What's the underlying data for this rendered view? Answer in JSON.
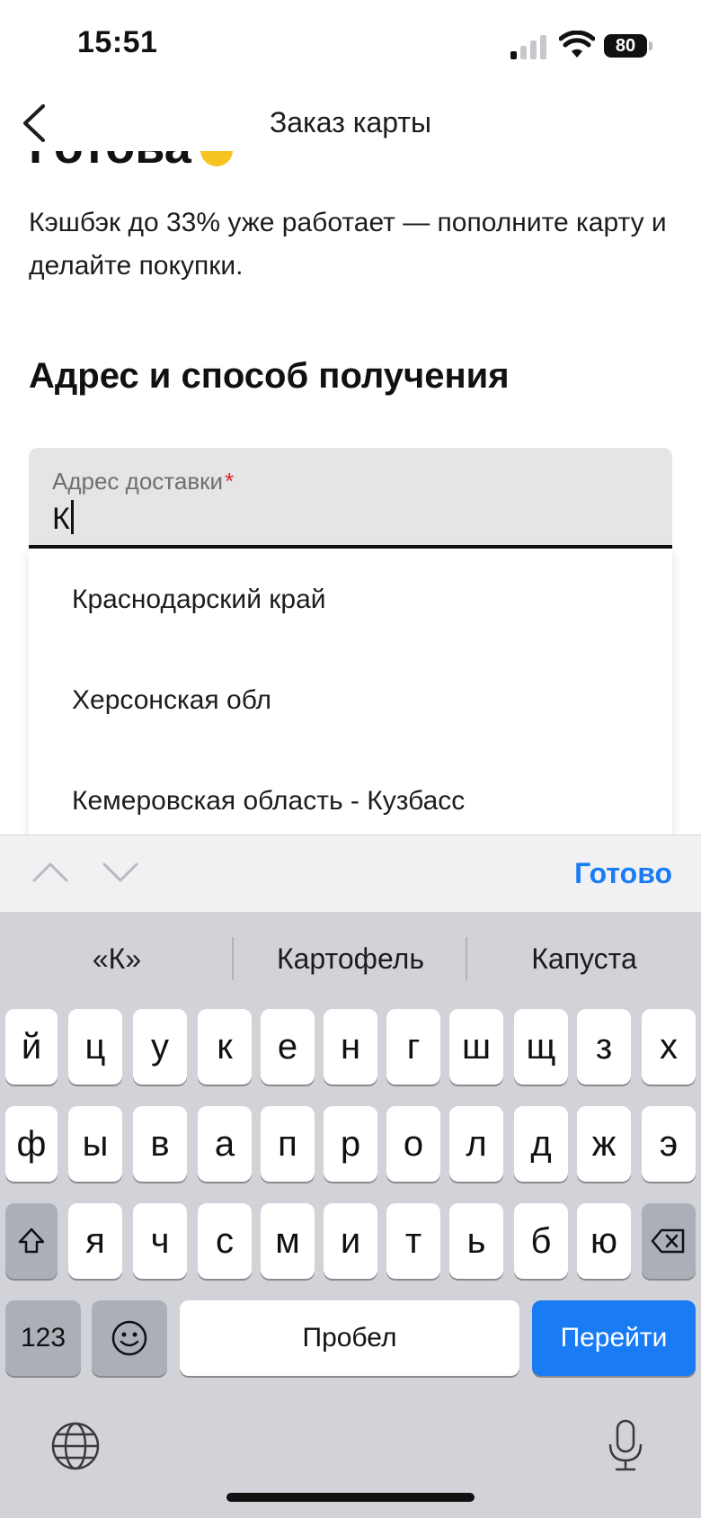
{
  "status_bar": {
    "time": "15:51",
    "battery": "80"
  },
  "nav": {
    "title": "Заказ карты"
  },
  "content": {
    "hero_title": "Готова",
    "subtitle": "Кэшбэк до 33% уже работает — пополните карту и делайте покупки.",
    "section_title": "Адрес и способ получения"
  },
  "field": {
    "label": "Адрес доставки",
    "required_mark": "*",
    "value": "К"
  },
  "suggestions": [
    "Краснодарский край",
    "Херсонская обл",
    "Кемеровская область - Кузбасс"
  ],
  "accessory": {
    "done_label": "Готово"
  },
  "keyboard": {
    "predictions": [
      "«К»",
      "Картофель",
      "Капуста"
    ],
    "row1": [
      "й",
      "ц",
      "у",
      "к",
      "е",
      "н",
      "г",
      "ш",
      "щ",
      "з",
      "х"
    ],
    "row2": [
      "ф",
      "ы",
      "в",
      "а",
      "п",
      "р",
      "о",
      "л",
      "д",
      "ж",
      "э"
    ],
    "row3": [
      "я",
      "ч",
      "с",
      "м",
      "и",
      "т",
      "ь",
      "б",
      "ю"
    ],
    "numbers_label": "123",
    "space_label": "Пробел",
    "go_label": "Перейти"
  },
  "icons": {
    "back": "chevron-left-icon",
    "up": "chevron-up-icon",
    "down": "chevron-down-icon",
    "shift": "shift-icon",
    "backspace": "backspace-icon",
    "emoji": "emoji-icon",
    "globe": "globe-icon",
    "mic": "mic-icon"
  },
  "colors": {
    "accent": "#1a7cf5",
    "required": "#e0242b",
    "keyboard_bg": "#d1d3d9"
  }
}
